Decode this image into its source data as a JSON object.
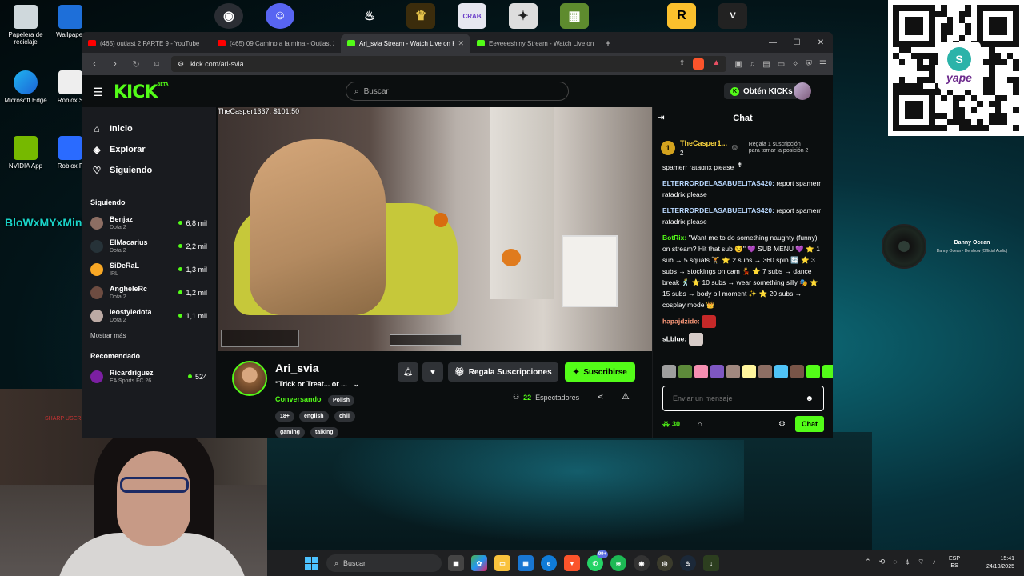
{
  "desktop": {
    "icons_left": [
      "Papelera de reciclaje",
      "Wallpaper",
      "Microsoft Edge",
      "Roblox S",
      "NVIDIA App",
      "Roblox P"
    ],
    "overlay_name": "BloWxMYxMinE",
    "now_playing": {
      "title": "Danny Ocean",
      "subtitle": "Danny Ocean - Dembow (Official Audio)"
    },
    "qr_brand": "yape",
    "webcam_sign": "SHARP USER"
  },
  "browser": {
    "tabs": [
      {
        "label": "(465) outlast 2 PARTE 9 - YouTube",
        "type": "yt",
        "active": false
      },
      {
        "label": "(465) 09 Camino a la mina - Outlast 2",
        "type": "yt",
        "active": false
      },
      {
        "label": "Ari_svia Stream - Watch Live on Kick",
        "type": "kick",
        "active": true
      },
      {
        "label": "Eeveeeshiny Stream - Watch Live on Kick",
        "type": "kick",
        "active": false
      }
    ],
    "new_tab": "+",
    "url": "kick.com/ari-svia"
  },
  "kick": {
    "logo": "KICK",
    "logo_beta": "BETA",
    "search_placeholder": "Buscar",
    "get_kicks": "Obtén KICKs",
    "nav": [
      {
        "label": "Inicio",
        "icon": "home-icon"
      },
      {
        "label": "Explorar",
        "icon": "compass-icon"
      },
      {
        "label": "Siguiendo",
        "icon": "heart-icon"
      }
    ],
    "following_title": "Siguiendo",
    "following": [
      {
        "name": "Benjaz",
        "category": "Dota 2",
        "viewers": "6,8 mil"
      },
      {
        "name": "ElMacarius",
        "category": "Dota 2",
        "viewers": "2,2 mil"
      },
      {
        "name": "SiDeRaL",
        "category": "IRL",
        "viewers": "1,3 mil"
      },
      {
        "name": "AngheleRc",
        "category": "Dota 2",
        "viewers": "1,2 mil"
      },
      {
        "name": "leostyledota",
        "category": "Dota 2",
        "viewers": "1,1 mil"
      }
    ],
    "show_more": "Mostrar más",
    "recommended_title": "Recomendado",
    "recommended": [
      {
        "name": "Ricardriguez",
        "category": "EA Sports FC 26",
        "viewers": "524"
      }
    ],
    "video_label": "TheCasper1337: $101.50",
    "stream": {
      "name": "Ari_svia",
      "title": "\"Trick or Treat... or ...",
      "category": "Conversando",
      "tags": [
        "Polish",
        "18+",
        "english",
        "chill",
        "gaming",
        "talking"
      ],
      "gift_btn": "Regala Suscripciones",
      "sub_btn": "Suscribirse",
      "viewers_count": "22",
      "viewers_label": "Espectadores"
    },
    "chat": {
      "title": "Chat",
      "pinned": {
        "rank": "1",
        "name": "TheCasper1...",
        "count": "2",
        "gift_text": "Regala 1 suscripción para tomar la posición 2"
      },
      "messages": [
        {
          "user": "",
          "text": "spamerr ratadrix please",
          "color": "#ffffff"
        },
        {
          "user": "ELTERRORDELASABUELITAS420:",
          "text": "report spamerr ratadrix please",
          "color": "#b9d8ff"
        },
        {
          "user": "ELTERRORDELASABUELITAS420:",
          "text": "report spamerr ratadrix please",
          "color": "#b9d8ff"
        },
        {
          "user": "BotRix:",
          "text": "\"Want me to do something naughty (funny) on stream? Hit that sub 😏\" 💜 SUB MENU 💜 ⭐ 1 sub → 5 squats 🏋 ⭐ 2 subs → 360 spin 🔄 ⭐ 3 subs → stockings on cam 💃 ⭐ 7 subs → dance break 🕺 ⭐ 10 subs → wear something silly 🎭 ⭐ 15 subs → body oil moment ✨ ⭐ 20 subs → cosplay mode 👑",
          "color": "#53fc18"
        },
        {
          "user": "hapajdzide:",
          "text": "",
          "color": "#ff9a7a"
        },
        {
          "user": "sLblue:",
          "text": "",
          "color": "#ffffff"
        }
      ],
      "input_placeholder": "Enviar un mensaje",
      "points": "30",
      "send": "Chat"
    }
  },
  "taskbar": {
    "search": "Buscar",
    "badge": "99+",
    "lang": [
      "ESP",
      "ES"
    ],
    "time": "15:41",
    "date": "24/10/2025"
  }
}
